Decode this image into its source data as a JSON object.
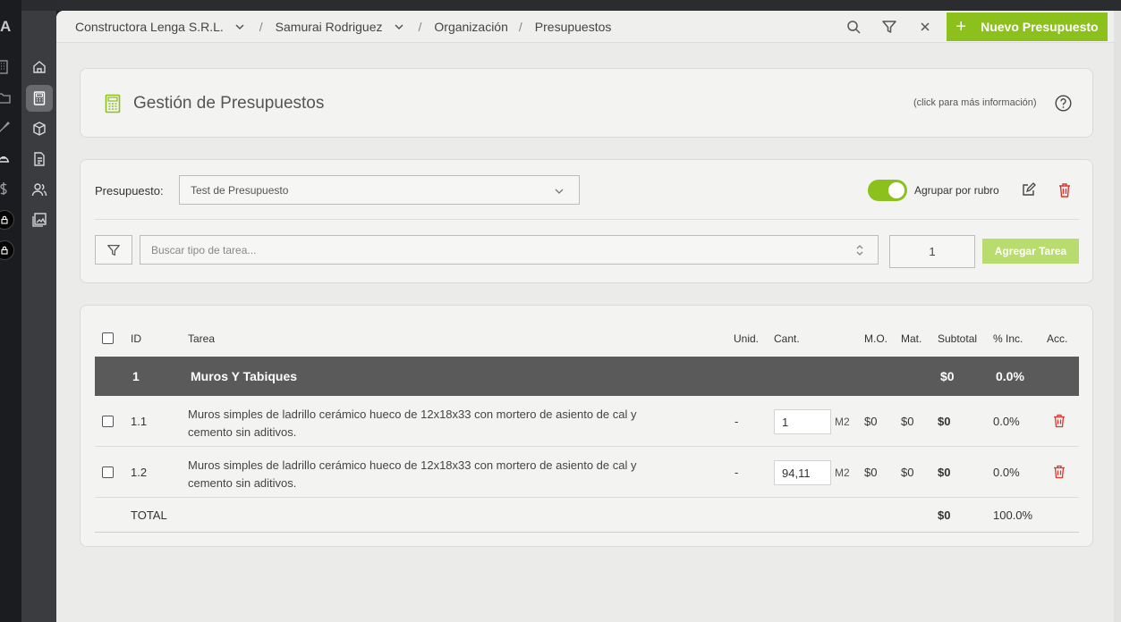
{
  "app": {
    "logo_letter": "A"
  },
  "header": {
    "breadcrumbs": [
      "Constructora Lenga S.R.L.",
      "Samurai Rodriguez",
      "Organización",
      "Presupuestos"
    ],
    "new_button_label": "Nuevo Presupuesto",
    "accent_color": "#8cc01c"
  },
  "title_card": {
    "title": "Gestión de Presupuestos",
    "info_text": "(click para más información)"
  },
  "budget": {
    "label": "Presupuesto:",
    "selected": "Test de Presupuesto",
    "group_toggle_label": "Agrupar por rubro",
    "group_toggle_on": true,
    "search_placeholder": "Buscar tipo de tarea...",
    "quantity": "1",
    "add_button_label": "Agregar Tarea"
  },
  "table": {
    "columns": [
      "ID",
      "Tarea",
      "Unid.",
      "Cant.",
      "M.O.",
      "Mat.",
      "Subtotal",
      "% Inc.",
      "Acc."
    ],
    "group": {
      "id": "1",
      "name": "Muros Y Tabiques",
      "subtotal": "$0",
      "inc": "0.0%"
    },
    "rows": [
      {
        "id": "1.1",
        "task_line1": "Muros simples de ladrillo cerámico hueco de 12x18x33 con mortero de asiento de cal y",
        "task_line2": "cemento sin aditivos.",
        "unit": "-",
        "cant": "1",
        "cant_unit": "M2",
        "mo": "$0",
        "mat": "$0",
        "subtotal": "$0",
        "inc": "0.0%"
      },
      {
        "id": "1.2",
        "task_line1": "Muros simples de ladrillo cerámico hueco de 12x18x33 con mortero de asiento de cal y",
        "task_line2": "cemento sin aditivos.",
        "unit": "-",
        "cant": "94,11",
        "cant_unit": "M2",
        "mo": "$0",
        "mat": "$0",
        "subtotal": "$0",
        "inc": "0.0%"
      }
    ],
    "total": {
      "label": "TOTAL",
      "subtotal": "$0",
      "inc": "100.0%"
    }
  }
}
